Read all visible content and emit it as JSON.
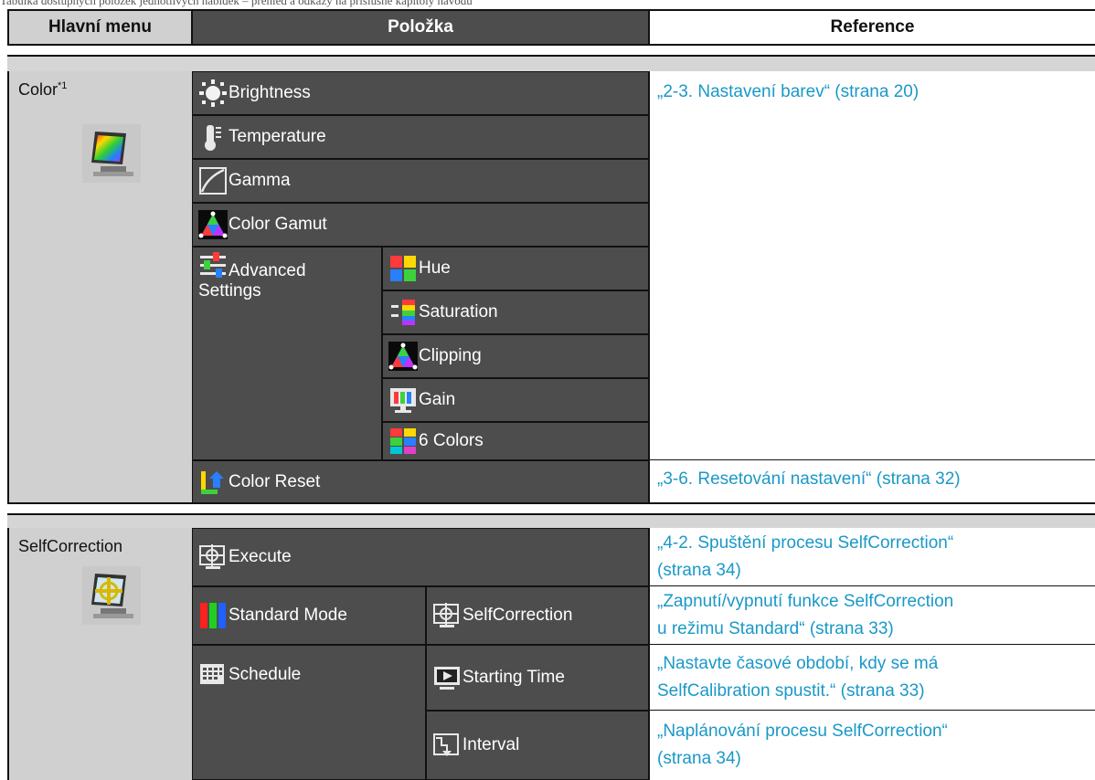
{
  "top_line": "Tabulka dostupných položek jednotlivých nabídek – přehled a odkazy na příslušné kapitoly návodu",
  "headers": {
    "main_menu": "Hlavní menu",
    "item": "Položka",
    "reference": "Reference"
  },
  "colors": {
    "header_dark": "#4d4d4d",
    "link": "#1a98c8",
    "band": "#d5d5d5",
    "main_col": "#d0d0d0"
  },
  "section_color": {
    "main_label": "Color",
    "main_sup": "*1",
    "main_icon": "color-monitor-icon",
    "items": [
      {
        "label": "Brightness",
        "icon": "brightness-icon"
      },
      {
        "label": "Temperature",
        "icon": "temperature-icon"
      },
      {
        "label": "Gamma",
        "icon": "gamma-icon"
      },
      {
        "label": "Color Gamut",
        "icon": "color-gamut-icon"
      },
      {
        "label": "Advanced Settings",
        "icon": "advanced-settings-icon"
      },
      {
        "label": "Color Reset",
        "icon": "color-reset-icon"
      }
    ],
    "advanced_sub": [
      {
        "label": "Hue",
        "icon": "hue-icon"
      },
      {
        "label": "Saturation",
        "icon": "saturation-icon"
      },
      {
        "label": "Clipping",
        "icon": "clipping-icon"
      },
      {
        "label": "Gain",
        "icon": "gain-icon"
      },
      {
        "label": "6 Colors",
        "icon": "six-colors-icon"
      }
    ],
    "refs": [
      "„2-3. Nastavení barev“ (strana 20)",
      "„3-6. Resetování nastavení“ (strana 32)"
    ]
  },
  "section_selfcorrection": {
    "main_label": "SelfCorrection",
    "main_icon": "selfcorrection-monitor-icon",
    "items": [
      {
        "label": "Execute",
        "icon": "execute-icon"
      },
      {
        "label": "Standard Mode",
        "icon": "standard-mode-icon"
      },
      {
        "label": "Schedule",
        "icon": "schedule-icon"
      }
    ],
    "sub": [
      {
        "label": "SelfCorrection",
        "icon": "selfcorrection-icon"
      },
      {
        "label": "Starting Time",
        "icon": "starting-time-icon"
      },
      {
        "label": "Interval",
        "icon": "interval-icon"
      }
    ],
    "refs": [
      {
        "line1": "„4-2. Spuštění procesu SelfCorrection“",
        "line2": "(strana 34)"
      },
      {
        "line1": "„Zapnutí/vypnutí funkce SelfCorrection",
        "line2": "u režimu Standard“ (strana 33)"
      },
      {
        "line1": "„Nastavte časové období, kdy se má",
        "line2": "SelfCalibration spustit.“ (strana 33)"
      },
      {
        "line1": "„Naplánování procesu SelfCorrection“",
        "line2": "(strana 34)"
      }
    ]
  }
}
